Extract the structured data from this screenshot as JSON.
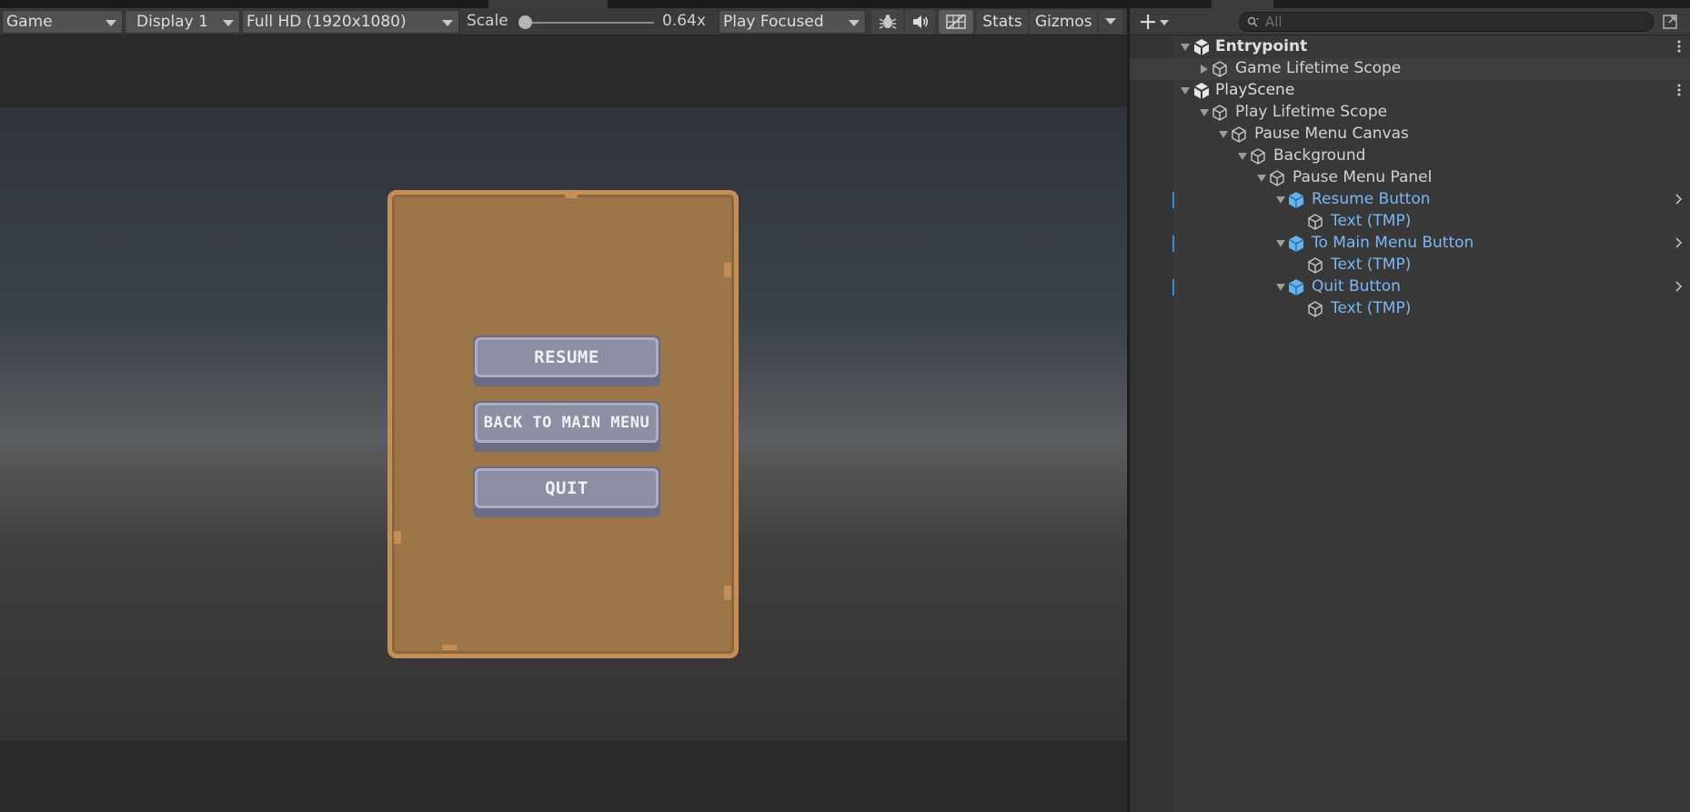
{
  "game_view": {
    "toolbar": {
      "view_mode": "Game",
      "display": "Display 1",
      "resolution": "Full HD (1920x1080)",
      "scale_label": "Scale",
      "scale_value": "0.64x",
      "play_mode": "Play Focused",
      "stats": "Stats",
      "gizmos": "Gizmos"
    },
    "pause_menu": {
      "buttons": [
        {
          "label": "RESUME"
        },
        {
          "label": "BACK TO MAIN MENU"
        },
        {
          "label": "QUIT"
        }
      ]
    }
  },
  "hierarchy": {
    "search": {
      "placeholder": "All"
    },
    "items": [
      {
        "label": "Entrypoint"
      },
      {
        "label": "Game Lifetime Scope"
      },
      {
        "label": "PlayScene"
      },
      {
        "label": "Play Lifetime Scope"
      },
      {
        "label": "Pause Menu Canvas"
      },
      {
        "label": "Background"
      },
      {
        "label": "Pause Menu Panel"
      },
      {
        "label": "Resume Button"
      },
      {
        "label": "Text (TMP)"
      },
      {
        "label": "To Main Menu Button"
      },
      {
        "label": "Text (TMP)"
      },
      {
        "label": "Quit Button"
      },
      {
        "label": "Text (TMP)"
      }
    ]
  },
  "colors": {
    "prefab_text": "#7fb6f2",
    "panel": "#9c7649",
    "panel_border": "#c58e55",
    "button_face": "#8c8ea3",
    "selection_bar": "#2d8fd6"
  }
}
